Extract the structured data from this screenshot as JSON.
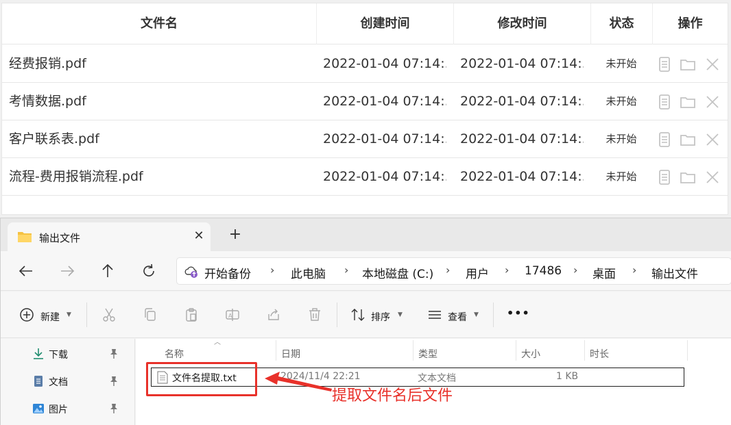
{
  "table": {
    "headers": [
      "文件名",
      "创建时间",
      "修改时间",
      "状态",
      "操作"
    ],
    "rows": [
      {
        "name": "经费报销.pdf",
        "created": "2022-01-04 07:14:...",
        "modified": "2022-01-04 07:14:...",
        "status": "未开始"
      },
      {
        "name": "考情数据.pdf",
        "created": "2022-01-04 07:14:...",
        "modified": "2022-01-04 07:14:...",
        "status": "未开始"
      },
      {
        "name": "客户联系表.pdf",
        "created": "2022-01-04 07:14:...",
        "modified": "2022-01-04 07:14:...",
        "status": "未开始"
      },
      {
        "name": "流程-费用报销流程.pdf",
        "created": "2022-01-04 07:14:...",
        "modified": "2022-01-04 07:14:...",
        "status": "未开始"
      }
    ],
    "row_actions": [
      "document-icon",
      "folder-icon",
      "close-icon"
    ]
  },
  "explorer": {
    "tab_title": "输出文件",
    "breadcrumbs": [
      "开始备份",
      "此电脑",
      "本地磁盘 (C:)",
      "用户",
      "17486",
      "桌面",
      "输出文件"
    ],
    "toolbar": {
      "new_label": "新建",
      "sort_label": "排序",
      "view_label": "查看",
      "more_label": "•••"
    },
    "sidebar": [
      {
        "label": "下载",
        "icon": "download-icon"
      },
      {
        "label": "文档",
        "icon": "document-icon"
      },
      {
        "label": "图片",
        "icon": "picture-icon"
      }
    ],
    "columns": [
      "名称",
      "日期",
      "类型",
      "大小",
      "时长"
    ],
    "file": {
      "name": "文件名提取.txt",
      "date": "2024/11/4 22:21",
      "type": "文本文档",
      "size": "1 KB"
    }
  },
  "annotation": {
    "text": "提取文件名后文件",
    "color": "#e8312a"
  }
}
